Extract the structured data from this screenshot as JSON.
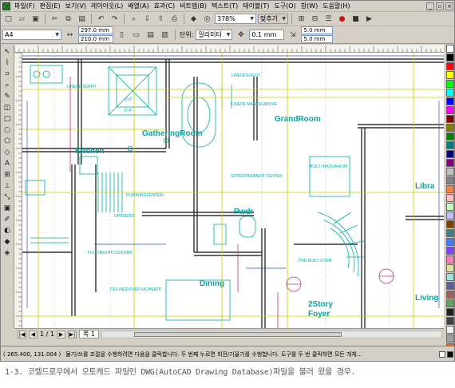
{
  "menu": [
    "파일(F)",
    "편집(E)",
    "보기(V)",
    "레이아웃(L)",
    "배열(A)",
    "효과(C)",
    "비트맵(B)",
    "텍스트(T)",
    "테이블(T)",
    "도구(O)",
    "창(W)",
    "도움말(H)"
  ],
  "toolbar": {
    "zoom": "378%",
    "snap": "맞추기"
  },
  "propbar": {
    "page_size": "A4",
    "width": "297.0 mm",
    "height": "210.0 mm",
    "units_label": "단위:",
    "units": "밀리미터",
    "nudge": "0.1 mm",
    "dup_x": "5.0 mm",
    "dup_y": "5.0 mm"
  },
  "drawing_labels": [
    {
      "text": "GatheringRoom",
      "color": "#00aaaa"
    },
    {
      "text": "GrandRoom",
      "color": "#00aaaa"
    },
    {
      "text": "Kitchen",
      "color": "#00aaaa"
    },
    {
      "text": "Libra",
      "color": "#00aaaa"
    },
    {
      "text": "Pwdr",
      "color": "#00aaaa"
    },
    {
      "text": "Dining",
      "color": "#00aaaa"
    },
    {
      "text": "2Story",
      "color": "#00aaaa"
    },
    {
      "text": "Foyer",
      "color": "#00aaaa"
    },
    {
      "text": "Living",
      "color": "#00aaaa"
    }
  ],
  "small_notes": [
    "ENTERTAINMENT CENTER",
    "LINEOF SOFFIT",
    "LINEOF MANTELABOVE",
    "FULLHEIGHTCOUNTER",
    "CEILINGDOVER NICHEAT8'",
    "PLANNINGCENTER",
    "BUILT-INAQUARIUM",
    "PRE-BUILT STAIR-",
    "UPRISERS",
    "9'-0\"",
    "8'-4\"",
    "LINEOFSOFFIT"
  ],
  "pagebar": {
    "page_counter": "1 / 1",
    "page_tab": "쪽 1"
  },
  "status": {
    "coords": "( 265.400, 131.004 )",
    "message": "물기/쓰를 조절을 수행하려면 다음을 클릭합니다. 두 번째 누르면 회전/기울기를 수행합니다. 도구를 두 번 클릭하면 모든 개체..."
  },
  "palette_colors": [
    "#ffffff",
    "#000000",
    "#ff0000",
    "#ffff00",
    "#00ff00",
    "#00ffff",
    "#0000ff",
    "#ff00ff",
    "#800000",
    "#808000",
    "#008000",
    "#008080",
    "#000080",
    "#800080",
    "#c0c0c0",
    "#808080",
    "#ff8040",
    "#ffc0c0",
    "#c0ffc0",
    "#c0c0ff",
    "#804000",
    "#408080",
    "#4080ff",
    "#8040ff",
    "#ff80c0",
    "#e0e0a0",
    "#a0e0e0",
    "#6060a0",
    "#a06060",
    "#60a060",
    "#202020",
    "#404040",
    "#f0f0f0",
    "#a0a0a0",
    "#ff6000"
  ],
  "caption": "1-3. 코렐드로우에서 오토캐드 파일인 DWG(AutoCAD Drawing Database)파일을 불러 왔을 경우."
}
